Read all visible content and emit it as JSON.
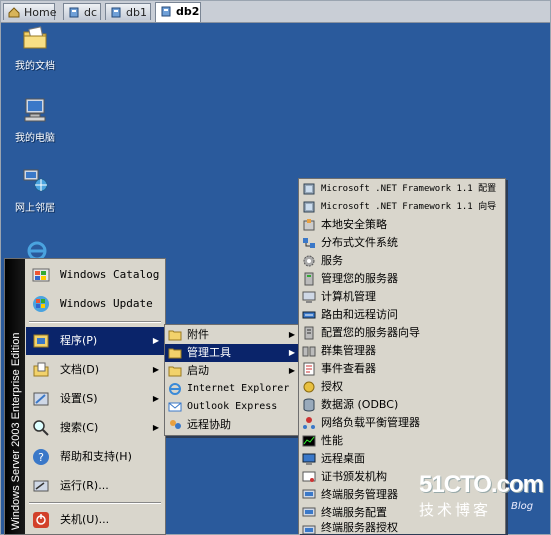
{
  "tabs": [
    {
      "label": "Home",
      "active": false
    },
    {
      "label": "dc",
      "active": false
    },
    {
      "label": "db1",
      "active": false
    },
    {
      "label": "db2",
      "active": true
    }
  ],
  "desktop": {
    "icons": [
      {
        "label": "我的文档",
        "icon": "folder-documents-icon"
      },
      {
        "label": "我的电脑",
        "icon": "computer-icon"
      },
      {
        "label": "网上邻居",
        "icon": "network-icon"
      }
    ]
  },
  "start_menu": {
    "banner": "Windows Server 2003 Enterprise Edition",
    "pinned": [
      {
        "label": "Windows Catalog"
      },
      {
        "label": "Windows Update"
      }
    ],
    "items": [
      {
        "label": "程序(P)",
        "arrow": true,
        "selected": true
      },
      {
        "label": "文档(D)",
        "arrow": true
      },
      {
        "label": "设置(S)",
        "arrow": true
      },
      {
        "label": "搜索(C)",
        "arrow": true
      },
      {
        "label": "帮助和支持(H)",
        "arrow": false
      },
      {
        "label": "运行(R)...",
        "arrow": false
      },
      {
        "label": "关机(U)...",
        "arrow": false
      }
    ]
  },
  "programs_menu": {
    "items": [
      {
        "label": "附件",
        "arrow": true
      },
      {
        "label": "管理工具",
        "arrow": true,
        "selected": true
      },
      {
        "label": "启动",
        "arrow": true
      },
      {
        "label": "Internet Explorer",
        "arrow": false
      },
      {
        "label": "Outlook Express",
        "arrow": false
      },
      {
        "label": "远程协助",
        "arrow": false
      }
    ]
  },
  "admin_tools_menu": {
    "items": [
      {
        "label": "Microsoft .NET Framework 1.1 配置"
      },
      {
        "label": "Microsoft .NET Framework 1.1 向导"
      },
      {
        "label": "本地安全策略"
      },
      {
        "label": "分布式文件系统"
      },
      {
        "label": "服务"
      },
      {
        "label": "管理您的服务器"
      },
      {
        "label": "计算机管理"
      },
      {
        "label": "路由和远程访问"
      },
      {
        "label": "配置您的服务器向导"
      },
      {
        "label": "群集管理器"
      },
      {
        "label": "事件查看器"
      },
      {
        "label": "授权"
      },
      {
        "label": "数据源 (ODBC)"
      },
      {
        "label": "网络负载平衡管理器"
      },
      {
        "label": "性能"
      },
      {
        "label": "远程桌面"
      },
      {
        "label": "证书颁发机构"
      },
      {
        "label": "终端服务管理器"
      },
      {
        "label": "终端服务配置"
      },
      {
        "label": "终端服务器授权"
      }
    ]
  },
  "watermark": {
    "site": "51CTO.com",
    "sub": "技术博客",
    "blog": "Blog"
  },
  "colors": {
    "desktop": "#2a5a9c",
    "highlight": "#0a246a",
    "menu": "#d9d6cc"
  }
}
